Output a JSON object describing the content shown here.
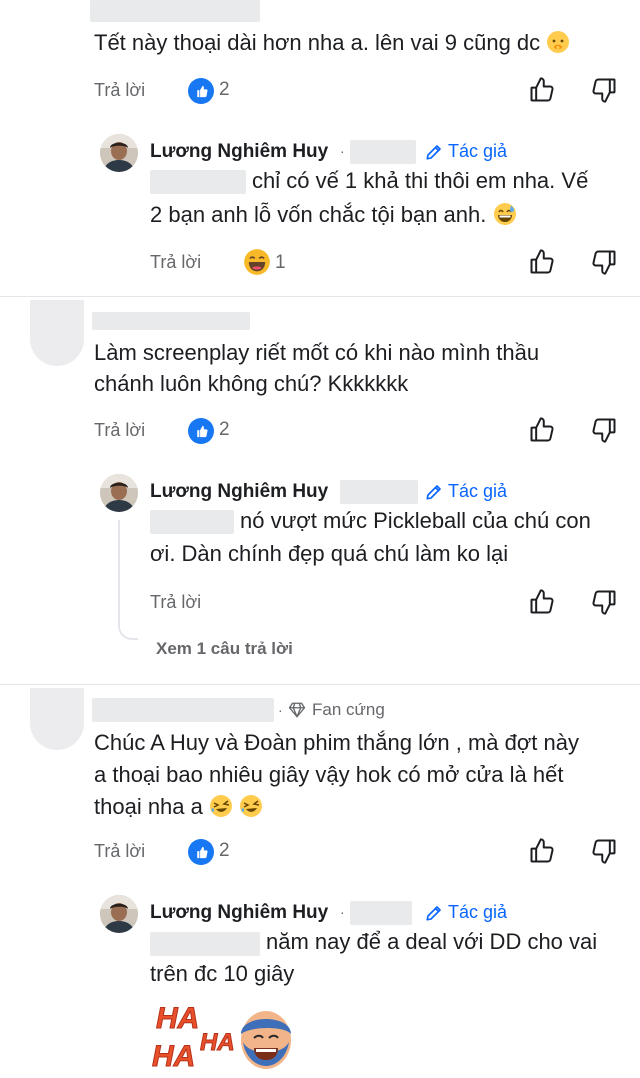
{
  "comments": [
    {
      "text": "Tết này thoại dài hơn nha a. lên vai 9 cũng dc",
      "reply_label": "Trả lời",
      "like_count": "2"
    },
    {
      "author": "Lương Nghiêm Huy",
      "author_badge": "Tác giả",
      "text_line1": "chỉ có vế 1 khả thi thôi em nha. Vế",
      "text_line2": "2 bạn anh lỗ vốn chắc tội bạn anh.",
      "reply_label": "Trả lời",
      "reaction_count": "1"
    },
    {
      "text_line1": "Làm screenplay riết mốt có khi nào mình thầu",
      "text_line2": "chánh luôn không chú? Kkkkkkk",
      "reply_label": "Trả lời",
      "like_count": "2"
    },
    {
      "author": "Lương Nghiêm Huy",
      "author_badge": "Tác giả",
      "text_line1": "nó vượt mức Pickleball của chú con",
      "text_line2": "ơi. Dàn chính đẹp quá chú làm ko lại",
      "reply_label": "Trả lời",
      "view_more": "Xem 1 câu trả lời"
    },
    {
      "badge": "Fan cứng",
      "text_line1": "Chúc A Huy và Đoàn phim thắng lớn , mà đợt này",
      "text_line2": "a thoại bao nhiêu giây vậy hok có mở cửa là hết",
      "text_line3": "thoại nha a",
      "reply_label": "Trả lời",
      "like_count": "2"
    },
    {
      "author": "Lương Nghiêm Huy",
      "author_badge": "Tác giả",
      "text_line1": "năm nay để a deal với DD cho vai",
      "text_line2": "trên đc 10 giây",
      "sticker_text": "HA HA HA"
    }
  ],
  "icons": {
    "like": "thumbs-up-outline-icon",
    "dislike": "thumbs-down-outline-icon",
    "author": "pencil-icon",
    "fan": "diamond-icon"
  },
  "colors": {
    "accent": "#0866ff",
    "like_badge": "#1877f2",
    "muted": "#65676b"
  }
}
